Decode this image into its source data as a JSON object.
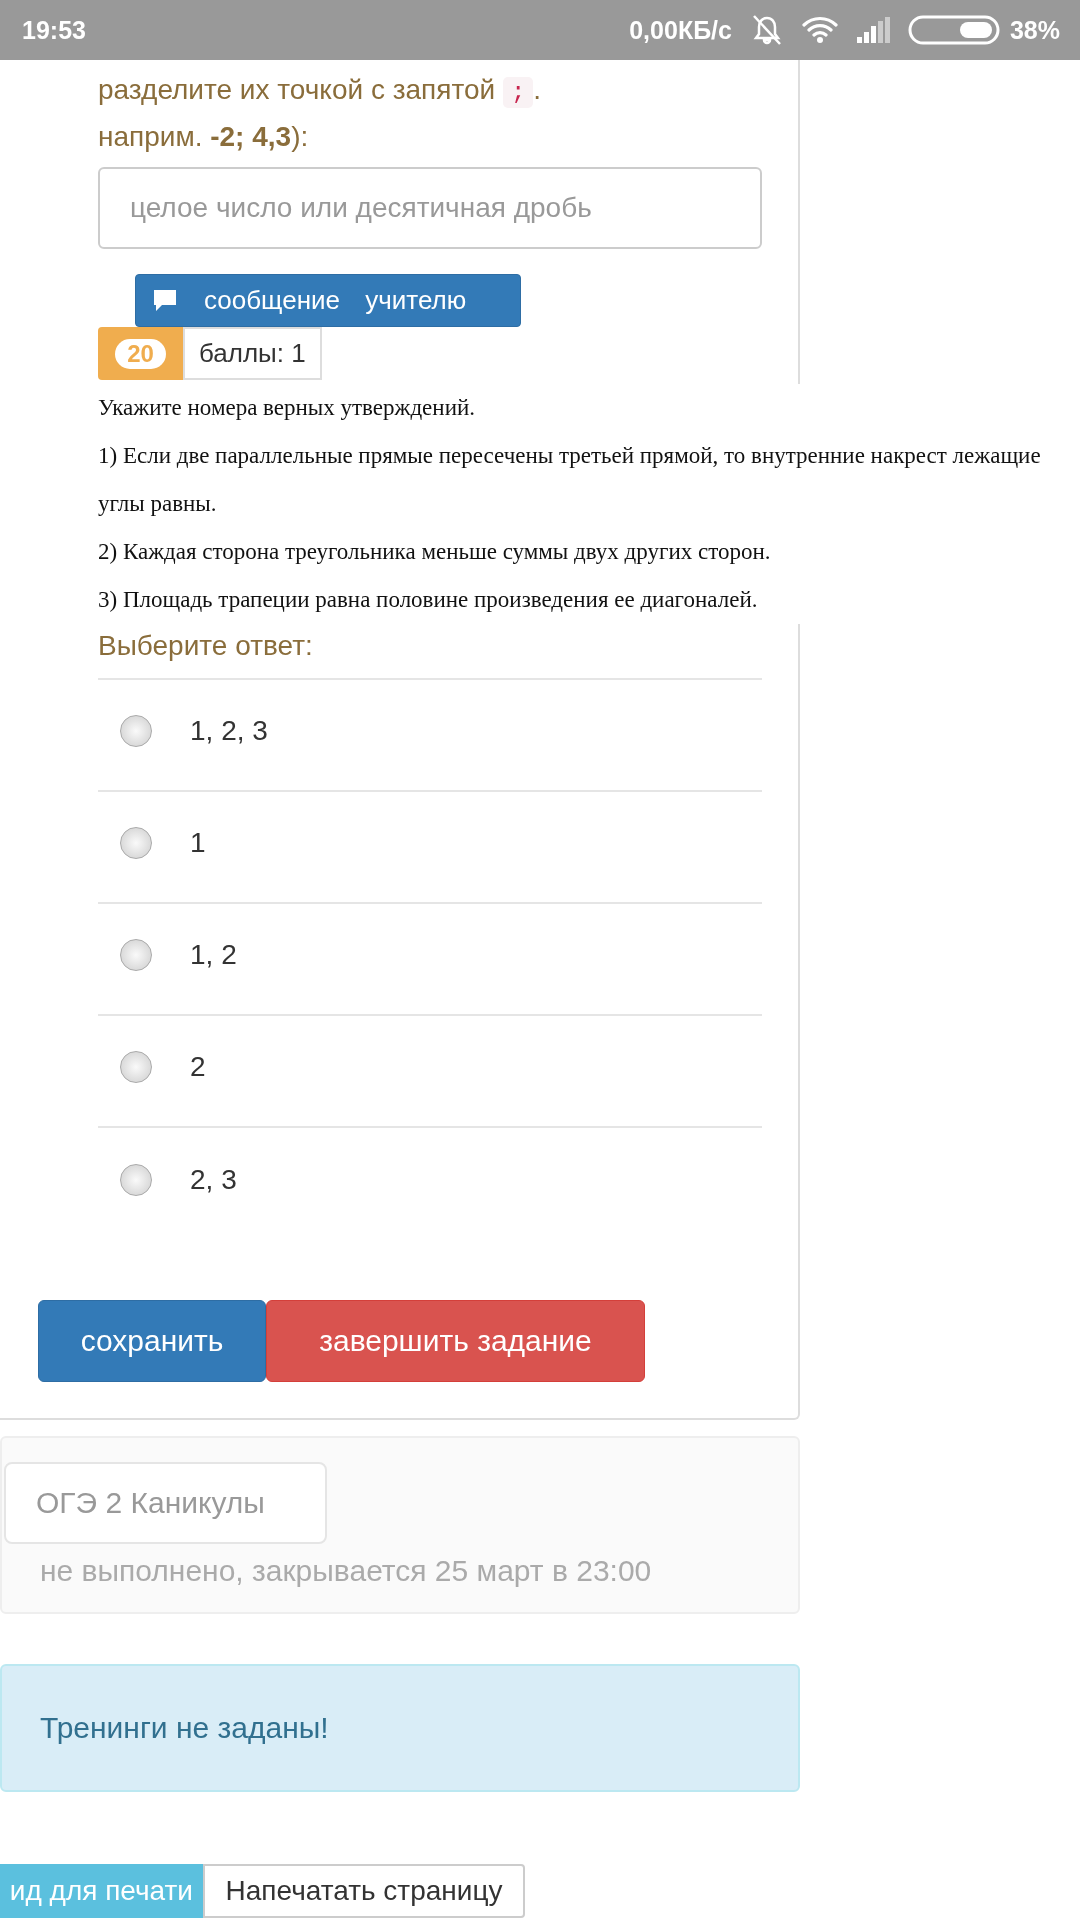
{
  "status_bar": {
    "time": "19:53",
    "speed": "0,00КБ/с",
    "battery": "38%"
  },
  "answer_hint": {
    "text": "разделите их точкой с запятой",
    "code": ";",
    "after": ".",
    "example": "наприм. **-2; 4,3**):"
  },
  "answer_field": {
    "placeholder": "целое число или десятичная дробь"
  },
  "message_button": {
    "label": "сообщение учителю"
  },
  "score": {
    "badge": "20",
    "label": "баллы: 1"
  },
  "question": [
    "Укажите номера верных утверждений.",
    "1) Если две параллельные прямые пересечены третьей прямой, то внутренние накрест лежащие углы равны.",
    "2) Каждая сторона треугольника меньше суммы двух других сторон.",
    "3) Площадь трапеции равна половине произведения ее диагоналей."
  ],
  "prompt": "Выберите ответ:",
  "options": [
    {
      "label": "1, 2, 3",
      "selected": false
    },
    {
      "label": "1",
      "selected": false
    },
    {
      "label": "1, 2",
      "selected": false
    },
    {
      "label": "2",
      "selected": false
    },
    {
      "label": "2, 3",
      "selected": false
    }
  ],
  "buttons": [
    {
      "kind": "primary",
      "label": "сохранить"
    },
    {
      "kind": "danger",
      "label": "завершить задание"
    }
  ],
  "assignment": {
    "title": "ОГЭ 2 Каникулы",
    "status": "не выполнено, закрывается 25 март в 23:00"
  },
  "alert": "Тренинги не заданы!",
  "print_bar": [
    {
      "kind": "info",
      "label": "ид для печати"
    },
    {
      "kind": "default",
      "label": "Напечатать страницу"
    }
  ]
}
